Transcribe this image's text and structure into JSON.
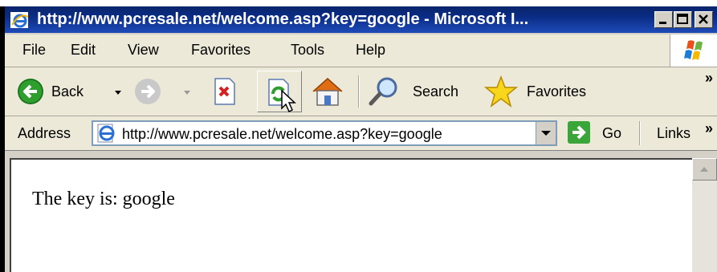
{
  "window": {
    "title": "http://www.pcresale.net/welcome.asp?key=google - Microsoft I...",
    "title_icon": "ie-icon",
    "controls": [
      "minimize",
      "maximize",
      "close"
    ]
  },
  "menu": {
    "items": [
      "File",
      "Edit",
      "View",
      "Favorites",
      "Tools",
      "Help"
    ]
  },
  "toolbar": {
    "back_label": "Back",
    "search_label": "Search",
    "favorites_label": "Favorites",
    "more_glyph": "»"
  },
  "address_bar": {
    "label": "Address",
    "url": "http://www.pcresale.net/welcome.asp?key=google",
    "go_label": "Go",
    "links_label": "Links",
    "links_more": "»"
  },
  "page": {
    "text": "The key is: google"
  },
  "colors": {
    "title_bar": "#0a246a",
    "chrome": "#d4d0c8",
    "toolbar_bg": "#ece9d8",
    "go_green": "#3aa63a"
  }
}
